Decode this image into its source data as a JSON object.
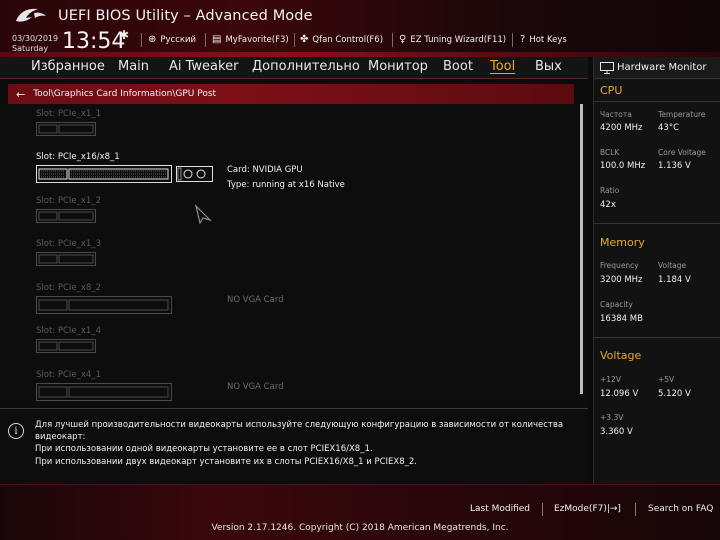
{
  "header": {
    "title": "UEFI BIOS Utility – Advanced Mode",
    "date": "03/30/2019",
    "weekday": "Saturday",
    "time": "13:54",
    "items": [
      {
        "icon": "globe-icon",
        "label": "Русский"
      },
      {
        "icon": "favorite-icon",
        "label": "MyFavorite(F3)"
      },
      {
        "icon": "fan-icon",
        "label": "Qfan Control(F6)"
      },
      {
        "icon": "lightbulb-icon",
        "label": "EZ Tuning Wizard(F11)"
      },
      {
        "icon": "hotkeys-icon",
        "label": "Hot Keys"
      }
    ]
  },
  "nav": {
    "tabs": [
      "Избранное",
      "Main",
      "Ai Tweaker",
      "Дополнительно",
      "Монитор",
      "Boot",
      "Tool",
      "Вых"
    ],
    "active": "Tool"
  },
  "breadcrumb": "Tool\\Graphics Card Information\\GPU Post",
  "slots": [
    {
      "label": "Slot: PCIe_x1_1",
      "state": "dim"
    },
    {
      "label": "Slot: PCIe_x16/x8_1",
      "state": "on",
      "card": "Card: NVIDIA GPU",
      "type": "Type: running at x16 Native"
    },
    {
      "label": "Slot: PCIe_x1_2",
      "state": "dim"
    },
    {
      "label": "Slot: PCIe_x1_3",
      "state": "dim"
    },
    {
      "label": "Slot: PCIe_x8_2",
      "state": "dim",
      "status": "NO VGA Card"
    },
    {
      "label": "Slot: PCIe_x1_4",
      "state": "dim"
    },
    {
      "label": "Slot: PCIe_x4_1",
      "state": "dim",
      "status": "NO VGA Card"
    }
  ],
  "info": {
    "lines": [
      "Для лучшей производительности видеокарты используйте следующую конфигурацию в зависимости от количества",
      "видеокарт:",
      "При использовании одной видеокарты установите ее в слот PCIEX16/X8_1.",
      "При использовании двух видеокарт установите их в слоты PCIEX16/X8_1 и PCIEX8_2."
    ]
  },
  "hwmon": {
    "title": "Hardware Monitor",
    "cpu": {
      "heading": "CPU",
      "freq_label": "Частота",
      "freq": "4200 MHz",
      "temp_label": "Temperature",
      "temp": "43°C",
      "bclk_label": "BCLK",
      "bclk": "100.0 MHz",
      "vcore_label": "Core Voltage",
      "vcore": "1.136 V",
      "ratio_label": "Ratio",
      "ratio": "42x"
    },
    "memory": {
      "heading": "Memory",
      "freq_label": "Frequency",
      "freq": "3200 MHz",
      "volt_label": "Voltage",
      "volt": "1.184 V",
      "cap_label": "Capacity",
      "cap": "16384 MB"
    },
    "voltage": {
      "heading": "Voltage",
      "v12_label": "+12V",
      "v12": "12.096 V",
      "v5_label": "+5V",
      "v5": "5.120 V",
      "v33_label": "+3.3V",
      "v33": "3.360 V"
    }
  },
  "footer": {
    "last_modified": "Last Modified",
    "ezmode": "EzMode(F7)|→]",
    "search": "Search on FAQ",
    "version": "Version 2.17.1246. Copyright (C) 2018 American Megatrends, Inc."
  },
  "colors": {
    "accent": "#e8a928",
    "brand_red": "#7d1017"
  }
}
